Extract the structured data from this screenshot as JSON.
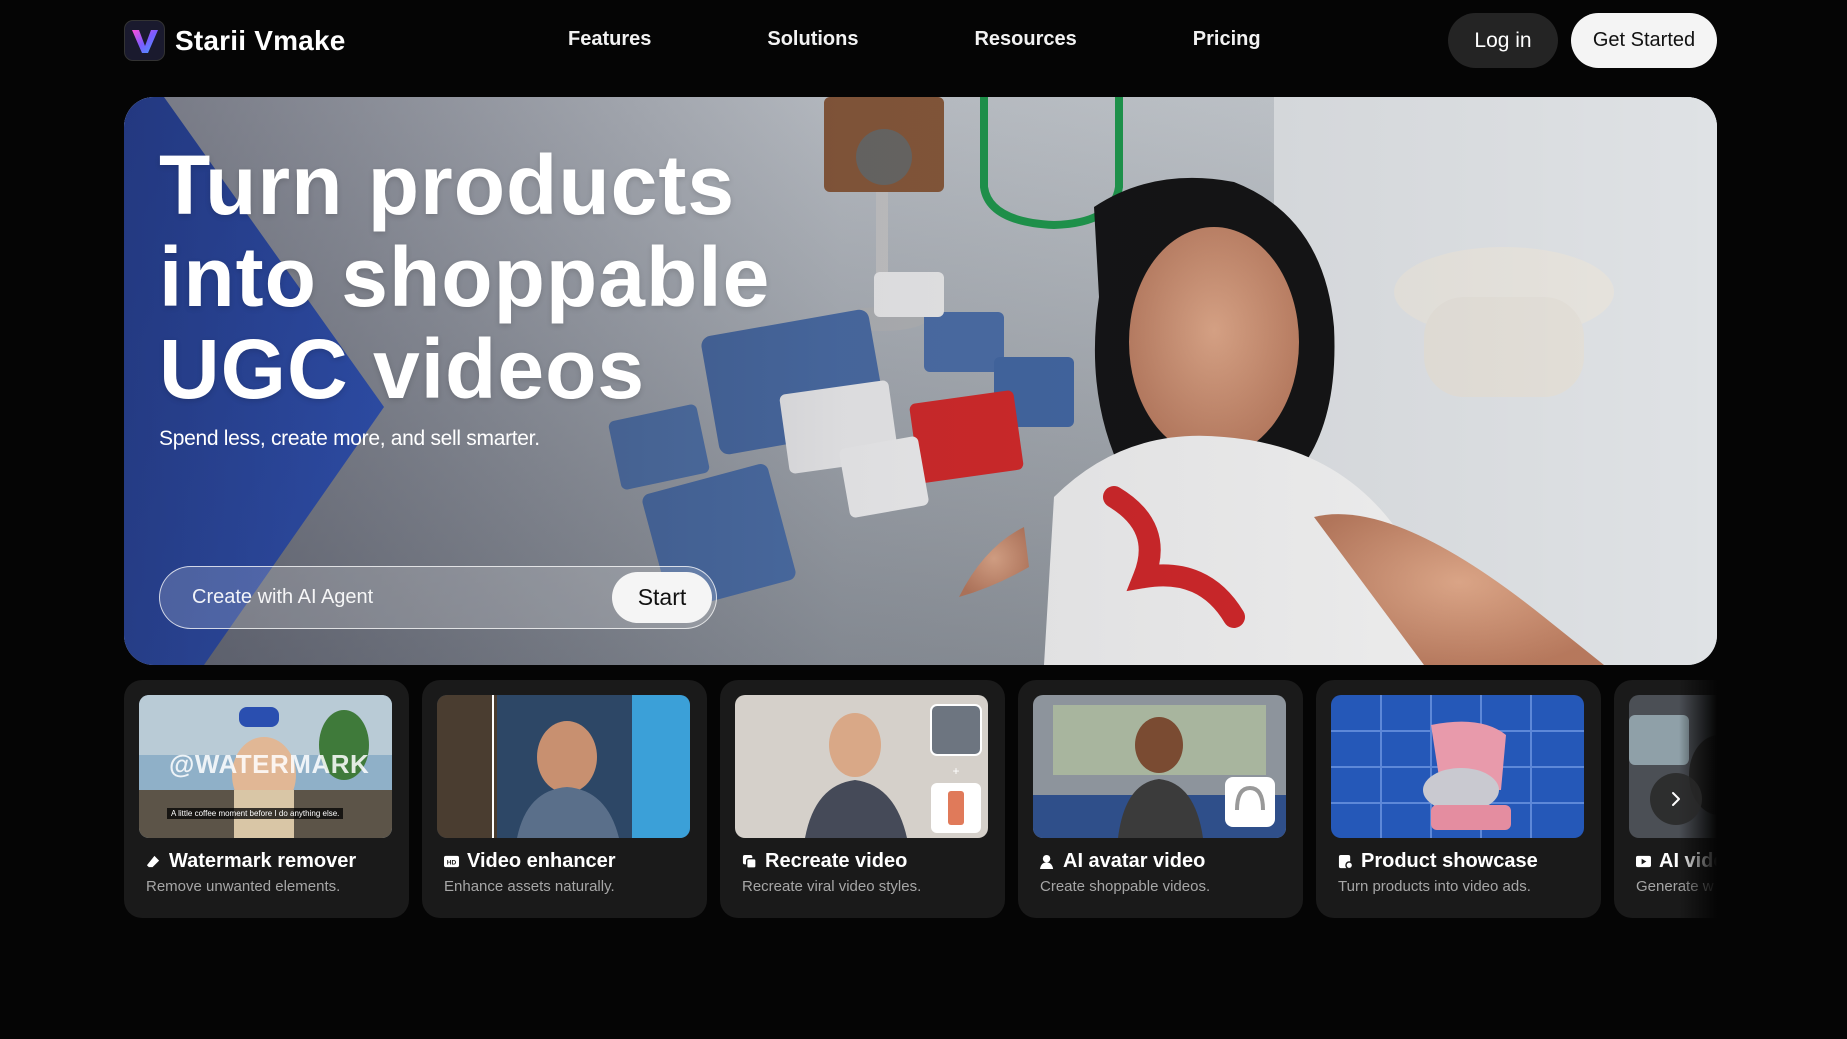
{
  "brand": {
    "name": "Starii Vmake",
    "logo_icon": "v-logo-icon",
    "accent": "#6b5cff"
  },
  "nav": {
    "links": [
      "Features",
      "Solutions",
      "Resources",
      "Pricing"
    ],
    "login_label": "Log in",
    "get_started_label": "Get Started"
  },
  "hero": {
    "title": "Turn products\ninto shoppable\nUGC videos",
    "subtitle": "Spend less, create more, and sell smarter.",
    "agent_placeholder": "Create with AI Agent",
    "start_label": "Start"
  },
  "cards": [
    {
      "title": "Watermark remover",
      "desc": "Remove unwanted elements.",
      "icon": "eraser-icon",
      "thumb_text": "@WATERMARK",
      "thumb_caption": "A little coffee moment before I do anything else."
    },
    {
      "title": "Video enhancer",
      "desc": "Enhance assets naturally.",
      "icon": "hd-icon"
    },
    {
      "title": "Recreate video",
      "desc": "Recreate viral video styles.",
      "icon": "recreate-icon"
    },
    {
      "title": "AI avatar video",
      "desc": "Create shoppable videos.",
      "icon": "avatar-icon"
    },
    {
      "title": "Product showcase",
      "desc": "Turn products into video ads.",
      "icon": "product-icon"
    },
    {
      "title": "AI video",
      "desc": "Generate w",
      "icon": "play-icon"
    }
  ],
  "next_icon": "chevron-right-icon"
}
